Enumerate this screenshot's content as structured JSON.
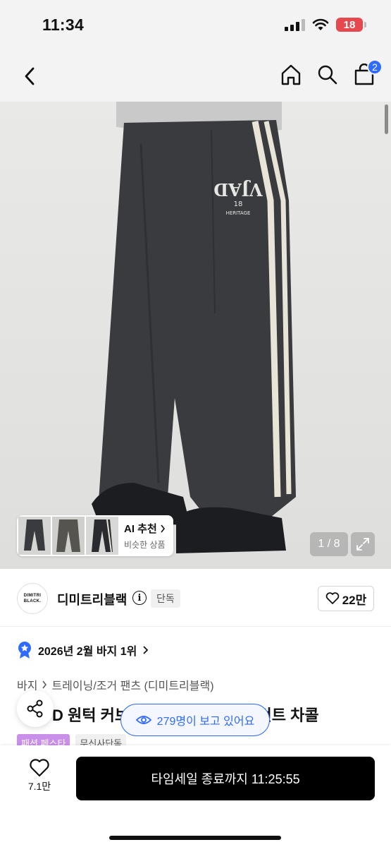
{
  "status_bar": {
    "time": "11:34",
    "battery": "18",
    "battery_color": "#e5484d"
  },
  "nav": {
    "cart_count": "2",
    "accent": "#2f6bff"
  },
  "hero": {
    "logo_line1": "VJAD",
    "logo_line2": "18",
    "logo_line3": "HERITAGE",
    "ai_title": "AI 추천",
    "ai_subtitle": "비슷한 상품",
    "page_counter": "1 / 8"
  },
  "brand": {
    "logo_line1": "DIMITRI",
    "logo_line2": "BLACK.",
    "name": "디미트리블랙",
    "badge": "단독",
    "likes": "22만"
  },
  "ranking": {
    "text": "2026년 2월 바지 1위"
  },
  "breadcrumb": {
    "category": "바지",
    "sub": "트레이닝/조거 팬츠 (디미트리블랙)"
  },
  "product": {
    "title": "D 원턱 커브 ______________ 피그먼트 차콜",
    "title_visible_start": "D 원턱 커브",
    "title_visible_end": "피그먼트 차콜",
    "tags": [
      "패션 페스타",
      "무신사단독"
    ]
  },
  "viewer": {
    "text": "279명이 보고 있어요"
  },
  "bottom": {
    "wish_count": "7.1만",
    "cta": "타임세일 종료까지 11:25:55"
  }
}
